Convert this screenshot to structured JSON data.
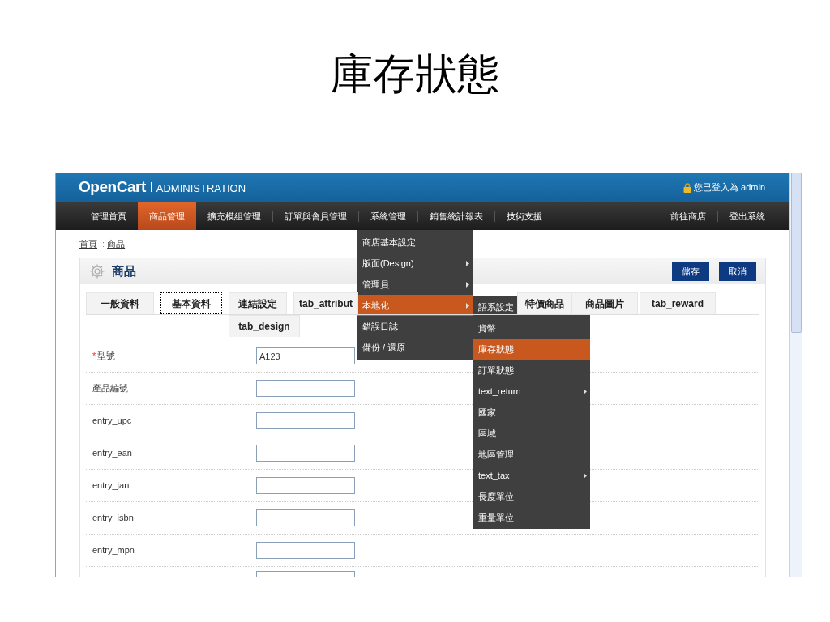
{
  "slide_title": "庫存狀態",
  "header": {
    "brand": "OpenCart",
    "brand_sub": "ADMINISTRATION",
    "login_text": "您已登入為 admin"
  },
  "nav": {
    "left": [
      {
        "label": "管理首頁",
        "selected": false
      },
      {
        "label": "商品管理",
        "selected": true
      },
      {
        "label": "擴充模組管理",
        "selected": false
      },
      {
        "label": "訂單與會員管理",
        "selected": false
      },
      {
        "label": "系統管理",
        "selected": false
      },
      {
        "label": "銷售統計報表",
        "selected": false
      },
      {
        "label": "技術支援",
        "selected": false
      }
    ],
    "right": [
      {
        "label": "前往商店"
      },
      {
        "label": "登出系統"
      }
    ]
  },
  "breadcrumb": [
    {
      "label": "首頁"
    },
    {
      "label": "商品"
    }
  ],
  "breadcrumb_separator": "::",
  "panel": {
    "title": "商品",
    "buttons": [
      "儲存",
      "取消"
    ]
  },
  "tabs_row_1": [
    {
      "label": "一般資料",
      "selected": false
    },
    {
      "label": "基本資料",
      "selected": true
    },
    {
      "label": "連結設定",
      "selected": false
    },
    {
      "label": "tab_attribut",
      "selected": false
    },
    {
      "label": "特價商品",
      "selected": false
    },
    {
      "label": "商品圖片",
      "selected": false
    },
    {
      "label": "tab_reward",
      "selected": false
    }
  ],
  "tabs_row_2": [
    {
      "label": "tab_design",
      "selected": false
    }
  ],
  "required_mark": "*",
  "fields": [
    {
      "label": "型號",
      "required": true,
      "value": "A123"
    },
    {
      "label": "產品編號",
      "required": false
    },
    {
      "label": "entry_upc",
      "required": false
    },
    {
      "label": "entry_ean",
      "required": false
    },
    {
      "label": "entry_jan",
      "required": false
    },
    {
      "label": "entry_isbn",
      "required": false
    },
    {
      "label": "entry_mpn",
      "required": false
    }
  ],
  "cut_off_field_below": true,
  "dropdown": [
    {
      "label": "商店基本設定",
      "selected": false
    },
    {
      "label": "版面(Design)",
      "has_submenu": true,
      "selected": false
    },
    {
      "label": "管理員",
      "has_submenu": true,
      "selected": false
    },
    {
      "label": "本地化",
      "has_submenu": true,
      "selected": true
    },
    {
      "label": "錯誤日誌",
      "selected": false
    },
    {
      "label": "備份 / 還原",
      "selected": false
    }
  ],
  "submenu": [
    {
      "label": "語系設定",
      "selected": false
    },
    {
      "label": "貨幣",
      "selected": false
    },
    {
      "label": "庫存狀態",
      "selected": true
    },
    {
      "label": "訂單狀態",
      "selected": false
    },
    {
      "label": "text_return",
      "has_submenu": true,
      "selected": false
    },
    {
      "label": "國家",
      "selected": false
    },
    {
      "label": "區域",
      "selected": false
    },
    {
      "label": "地區管理",
      "selected": false
    },
    {
      "label": "text_tax",
      "has_submenu": true,
      "selected": false
    },
    {
      "label": "長度單位",
      "selected": false
    },
    {
      "label": "重量單位",
      "selected": false
    }
  ]
}
